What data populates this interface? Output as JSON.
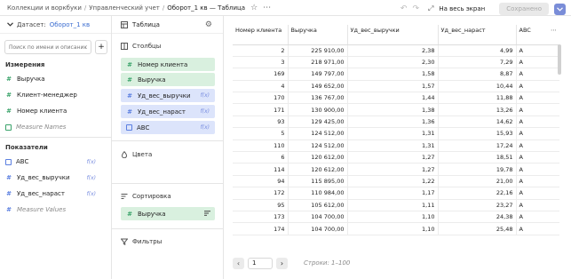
{
  "breadcrumbs": [
    "Коллекции и воркбуки",
    "Управленческий учет"
  ],
  "page_title": "Оборот_1 кв — Таблица",
  "toolbar": {
    "fullscreen_label": "На весь экран",
    "save_label": "Сохранено"
  },
  "dataset": {
    "label": "Датасет:",
    "name": "Оборот_1 кв",
    "search_placeholder": "Поиск по имени и описанию",
    "dimensions_title": "Измерения",
    "dimensions": [
      "Выручка",
      "Клиент-менеджер",
      "Номер клиента",
      "Measure Names"
    ],
    "measures_title": "Показатели",
    "measures": [
      "ABC",
      "Уд_вес_выручки",
      "Уд_вес_нараст",
      "Measure Values"
    ],
    "fx_label": "f(x)"
  },
  "wizard": {
    "visualization": "Таблица",
    "columns_title": "Столбцы",
    "columns": [
      "Номер клиента",
      "Выручка",
      "Уд_вес_выручки",
      "Уд_вес_нараст",
      "ABC"
    ],
    "color_title": "Цвета",
    "sort_title": "Сортировка",
    "sort_items": [
      "Выручка"
    ],
    "filters_title": "Фильтры"
  },
  "table": {
    "headers": [
      "Номер клиента",
      "Выручка",
      "Уд_вес_выручки",
      "Уд_вес_нараст",
      "ABC"
    ],
    "rows": [
      [
        "2",
        "225 910,00",
        "2,38",
        "4,99",
        "A"
      ],
      [
        "3",
        "218 971,00",
        "2,30",
        "7,29",
        "A"
      ],
      [
        "169",
        "149 797,00",
        "1,58",
        "8,87",
        "A"
      ],
      [
        "4",
        "149 652,00",
        "1,57",
        "10,44",
        "A"
      ],
      [
        "170",
        "136 767,00",
        "1,44",
        "11,88",
        "A"
      ],
      [
        "171",
        "130 900,00",
        "1,38",
        "13,26",
        "A"
      ],
      [
        "93",
        "129 425,00",
        "1,36",
        "14,62",
        "A"
      ],
      [
        "5",
        "124 512,00",
        "1,31",
        "15,93",
        "A"
      ],
      [
        "110",
        "124 512,00",
        "1,31",
        "17,24",
        "A"
      ],
      [
        "6",
        "120 612,00",
        "1,27",
        "18,51",
        "A"
      ],
      [
        "114",
        "120 612,00",
        "1,27",
        "19,78",
        "A"
      ],
      [
        "94",
        "115 895,00",
        "1,22",
        "21,00",
        "A"
      ],
      [
        "172",
        "110 984,00",
        "1,17",
        "22,16",
        "A"
      ],
      [
        "95",
        "105 612,00",
        "1,11",
        "23,27",
        "A"
      ],
      [
        "173",
        "104 700,00",
        "1,10",
        "24,38",
        "A"
      ],
      [
        "174",
        "104 700,00",
        "1,10",
        "25,48",
        "A"
      ]
    ]
  },
  "pagination": {
    "page": "1",
    "rows_label": "Строки: 1–100"
  },
  "colors": {
    "accent": "#7a8dd8",
    "dimension": "#3aa36a",
    "measure": "#5b7fe0",
    "pill_green": "#d9f0df",
    "pill_blue": "#dce4fb"
  }
}
